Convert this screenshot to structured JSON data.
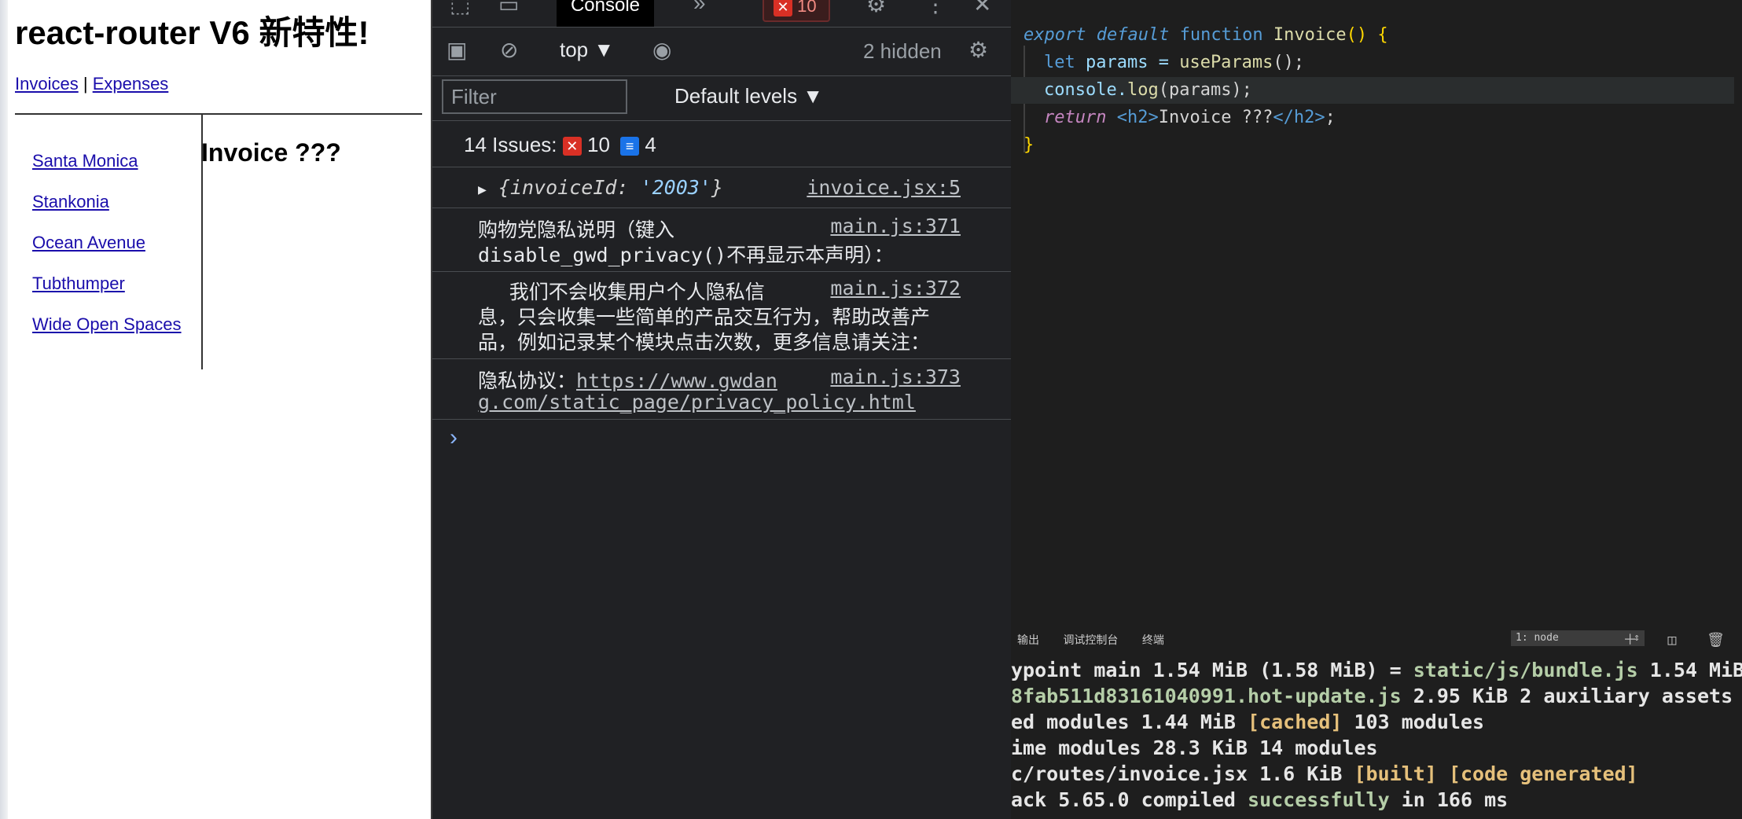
{
  "app": {
    "title": "react-router V6 新特性!",
    "nav": {
      "invoices": "Invoices",
      "separator": "|",
      "expenses": "Expenses"
    },
    "invoices": [
      "Santa Monica",
      "Stankonia",
      "Ocean Avenue",
      "Tubthumper",
      "Wide Open Spaces"
    ],
    "detail_heading": "Invoice ???"
  },
  "devtools": {
    "active_tab": "Console",
    "more_tabs": "»",
    "error_count": "10",
    "context": "top ▼",
    "hidden": "2 hidden",
    "filter_placeholder": "Filter",
    "levels": "Default levels ▼",
    "issues_label": "14 Issues:",
    "issues_errors": "10",
    "issues_info": "4",
    "messages": [
      {
        "source": "invoice.jsx:5",
        "key": "invoiceId",
        "value": "'2003'"
      },
      {
        "source": "main.js:371",
        "line1": "购物党隐私说明（键入",
        "line2": "disable_gwd_privacy()不再显示本声明）："
      },
      {
        "source": "main.js:372",
        "line1": "     我们不会收集用户个人隐私信",
        "line2": "息，只会收集一些简单的产品交互行为，帮助改善产",
        "line3": "品，例如记录某个模块点击次数，更多信息请关注："
      },
      {
        "source": "main.js:373",
        "line1": "隐私协议：",
        "link1": "https://www.gwdan",
        "line2": "g.com/static_page/privacy_policy.html"
      }
    ],
    "prompt": "›"
  },
  "editor": {
    "code": {
      "l1_export": "export default",
      "l1_function": "function",
      "l1_name": "Invoice",
      "l1_paren": "()",
      "l1_brace": "{",
      "l2_let": "let",
      "l2_rest": " params = ",
      "l2_call": "useParams",
      "l2_end": "();",
      "l3_console": "console.",
      "l3_log": "log",
      "l3_rest": "(params);",
      "l4_return": "return",
      "l4_open": "<h2>",
      "l4_text": "Invoice ???",
      "l4_close": "</h2>",
      "l4_end": ";",
      "l5": "}"
    }
  },
  "terminal": {
    "tabs": [
      "输出",
      "调试控制台",
      "终端"
    ],
    "shell_select": "1: node",
    "icons": "＋ ◫ 🗑",
    "lines": [
      {
        "a": "ypoint main 1.54 MiB (1.58 MiB) = ",
        "b": "static/js/bundle.js",
        "c": " 1.54 MiB"
      },
      {
        "a": "8fab511d83161040991.hot-update.js",
        "c": " 2.95 KiB 2 auxiliary assets"
      },
      {
        "a": "ed modules 1.44 MiB ",
        "b": "[cached]",
        "c": " 103 modules"
      },
      {
        "a": "ime modules 28.3 KiB 14 modules"
      },
      {
        "a": "c/routes/invoice.jsx 1.6 KiB ",
        "b": "[built] [code generated]"
      },
      {
        "a": "ack 5.65.0 compiled ",
        "b": "successfully",
        "c": " in 166 ms"
      }
    ]
  }
}
